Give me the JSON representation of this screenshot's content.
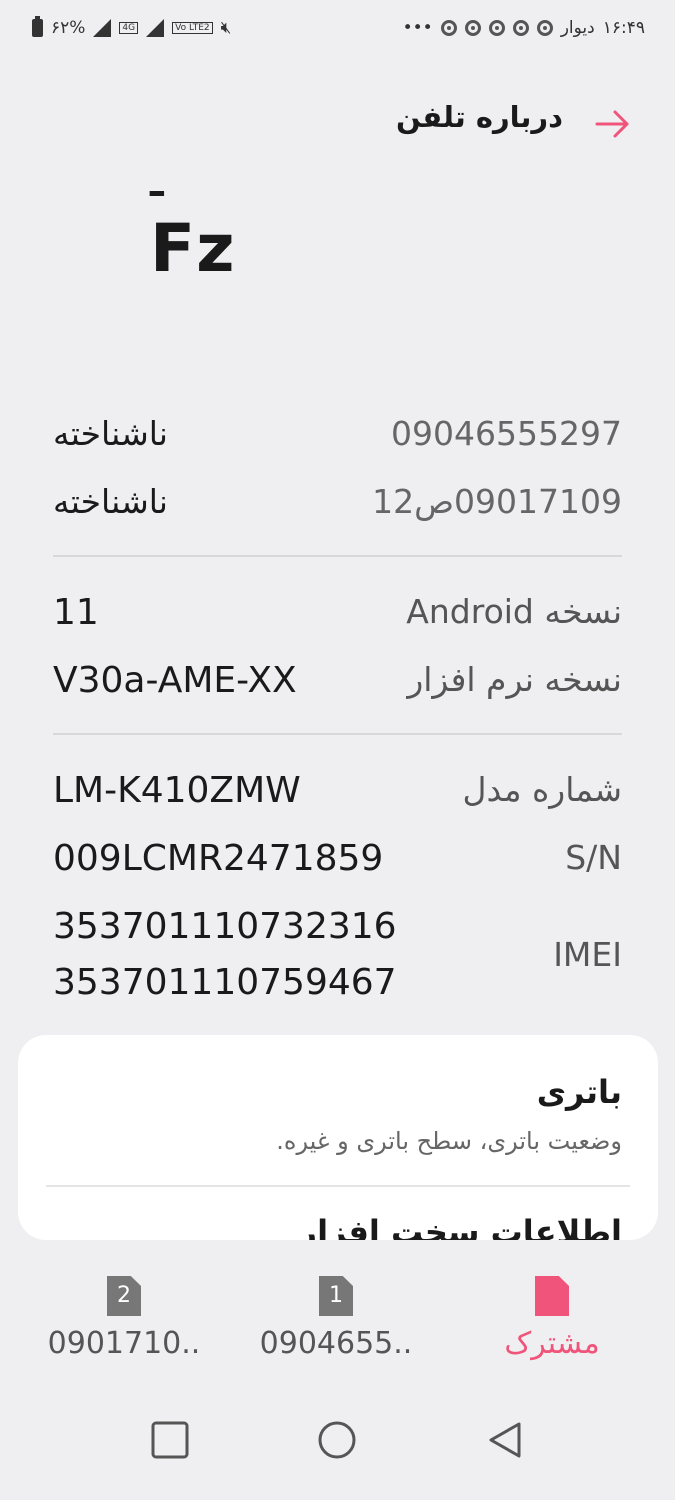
{
  "status_bar": {
    "battery": "۶۲%",
    "time": "۱۶:۴۹",
    "app_label": "دیوار",
    "network_4g": "4G",
    "volte": "Vo LTE2",
    "more": "•••"
  },
  "header": {
    "title": "درباره تلفن"
  },
  "device_name": {
    "partial_glyph": "ـ",
    "name": "Fz"
  },
  "phone_numbers": [
    {
      "label": "09046555297",
      "value": "ناشناخته"
    },
    {
      "label": "09017109ص12",
      "value": "ناشناخته"
    }
  ],
  "software": [
    {
      "label": "نسخه Android",
      "value": "11"
    },
    {
      "label": "نسخه نرم افزار",
      "value": "V30a-AME-XX"
    }
  ],
  "hardware": [
    {
      "label": "شماره مدل",
      "value": "LM-K410ZMW"
    },
    {
      "label": "S/N",
      "value": "009LCMR2471859"
    },
    {
      "label": "IMEI",
      "value_1": "353701110732316",
      "value_2": "353701110759467"
    }
  ],
  "card": {
    "title": "باتری",
    "description": "وضعیت باتری، سطح باتری و غیره.",
    "next_item_partial": "اطلاعات سخت افزار"
  },
  "sim_tabs": [
    {
      "badge": "2",
      "label": "0901710.."
    },
    {
      "badge": "1",
      "label": "0904655.."
    },
    {
      "badge": "",
      "label": "مشترک"
    }
  ],
  "colors": {
    "accent": "#f0547a",
    "background": "#efeff1",
    "card": "#ffffff"
  }
}
